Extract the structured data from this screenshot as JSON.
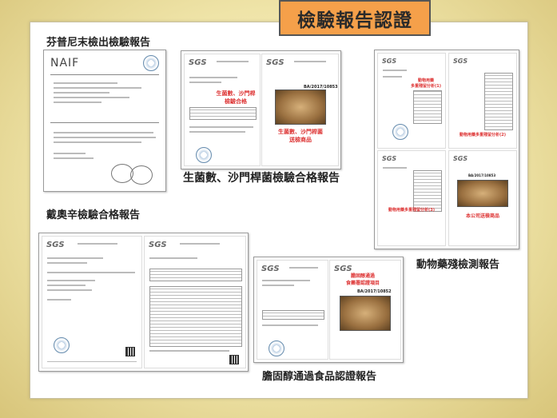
{
  "banner": {
    "title": "檢驗報告認證"
  },
  "captions": {
    "fipronil": "芬普尼末檢出檢驗報告",
    "bacteria": "生菌數、沙門桿菌檢驗合格報告",
    "dioxin": "戴奧辛檢驗合格報告",
    "animal_drug": "動物藥殘檢測報告",
    "cholesterol": "膽固醇通過食品認證報告"
  },
  "documents": {
    "fipronil": {
      "logo": "NAIF"
    },
    "bacteria": {
      "logos": [
        "SGS",
        "SGS"
      ],
      "red_text_1": "生菌數、沙門桿\n檢驗合格",
      "red_text_2": "生菌數、沙門桿菌\n送檢商品",
      "report_code": "BA/2017/10853"
    },
    "dioxin": {
      "logos": [
        "SGS",
        "SGS"
      ]
    },
    "animal_drug": {
      "logos": [
        "SGS",
        "SGS",
        "SGS",
        "SGS"
      ],
      "red_text_1": "動物用藥\n多重殘留分析(1)",
      "red_text_2": "動物用藥多重殘留分析(2)",
      "red_text_3": "動物用藥多重殘留分析(3)",
      "red_text_4": "本公司送檢商品",
      "report_code": "BA/2017/10853"
    },
    "cholesterol": {
      "logos": [
        "SGS",
        "SGS"
      ],
      "red_text_1": "膽固醇通過\n食藥署認證項目",
      "report_code": "BA/2017/10852"
    }
  }
}
